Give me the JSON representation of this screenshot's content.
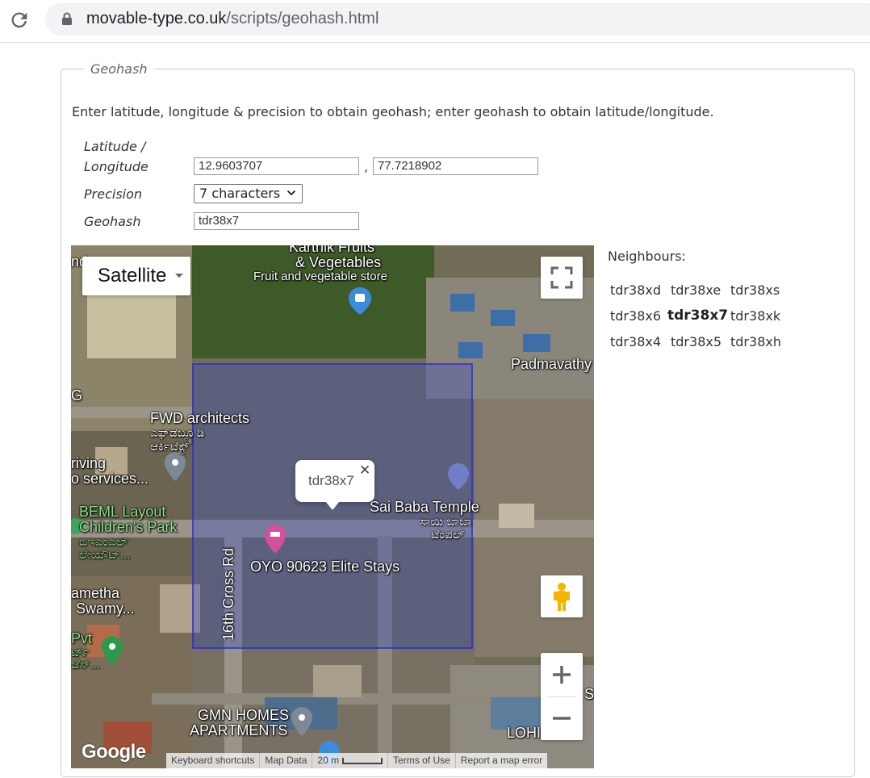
{
  "browser": {
    "url_domain": "movable-type.co.uk",
    "url_path": "/scripts/geohash.html"
  },
  "form": {
    "legend": "Geohash",
    "intro": "Enter latitude, longitude & precision to obtain geohash; enter geohash to obtain latitude/longitude.",
    "latlon_label_1": "Latitude /",
    "latlon_label_2": "Longitude",
    "latitude": "12.9603707",
    "comma": ",",
    "longitude": "77.7218902",
    "precision_label": "Precision",
    "precision_value": "7 characters",
    "geohash_label": "Geohash",
    "geohash_value": "tdr38x7"
  },
  "map": {
    "type_label": "Satellite",
    "popup_text": "tdr38x7",
    "popup_close": "✕",
    "labels": {
      "kartik1": "Karthik Fruits",
      "kartik2": "& Vegetables",
      "fruit_store": "Fruit and vegetable store",
      "padmavathy": "Padmavathy",
      "g": "G",
      "fwd": "FWD architects",
      "fwd_kn1": "ಎಫ್‌ಡಬ್ಲ್ಯೂಡಿ",
      "fwd_kn2": "ಆರ್ಕಿಟೆಕ್ಟ್",
      "driving1": "riving",
      "driving2": "o services...",
      "sai_baba": "Sai Baba Temple",
      "sai_baba_kn1": "ಸಾಯಿ ಬಾಬಾ",
      "sai_baba_kn2": "ಟೆಂಪಲ್",
      "beml1": "BEML Layout",
      "beml2": "Children's Park",
      "beml_kn1": "ಬಿಇಎಂಎಲ್",
      "beml_kn2": "ಲೇಯೌಟ್...",
      "oyo": "OYO 90623 Elite Stays",
      "cross_rd": "16th Cross Rd",
      "ameth1": "ametha",
      "ameth2": "Swamy...",
      "pvt": "Pvt",
      "pvt_kn1": "ರ್ಟ್",
      "pvt_kn2": "ಜೆಸ್...",
      "gmn1": "GMN HOMES",
      "gmn2": "APARTMENTS",
      "lohi": "LOHI",
      "s": "S",
      "nd": "nd"
    },
    "google": "Google",
    "attribution": {
      "keyboard": "Keyboard shortcuts",
      "map_data": "Map Data",
      "scale": "20 m",
      "terms": "Terms of Use",
      "report": "Report a map error"
    }
  },
  "neighbours": {
    "title": "Neighbours:",
    "grid": [
      [
        "tdr38xd",
        "tdr38xe",
        "tdr38xs"
      ],
      [
        "tdr38x6",
        "tdr38x7",
        "tdr38xk"
      ],
      [
        "tdr38x4",
        "tdr38x5",
        "tdr38xh"
      ]
    ]
  }
}
